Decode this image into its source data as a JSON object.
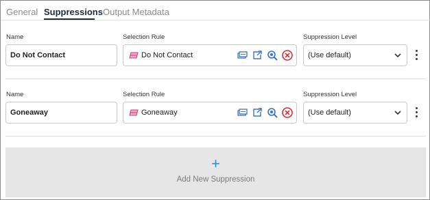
{
  "tabs": [
    {
      "label": "General",
      "active": false
    },
    {
      "label": "Suppressions",
      "active": true
    },
    {
      "label": "Output Metadata",
      "active": false
    }
  ],
  "labels": {
    "name": "Name",
    "selection_rule": "Selection Rule",
    "suppression_level": "Suppression Level"
  },
  "suppressions": [
    {
      "name": "Do Not Contact",
      "selection_rule": "Do Not Contact",
      "suppression_level": "(Use default)"
    },
    {
      "name": "Goneaway",
      "selection_rule": "Goneaway",
      "suppression_level": "(Use default)"
    }
  ],
  "add_button": {
    "icon": "plus-icon",
    "label": "Add New Suppression"
  },
  "colors": {
    "accent": "#2f8fd0",
    "active_tab": "#1f2a3a",
    "inactive_tab": "#8a8a8a",
    "remove_icon": "#e02b35",
    "search_icon": "#3b73c7",
    "add_panel_bg": "#e6e6e6"
  }
}
